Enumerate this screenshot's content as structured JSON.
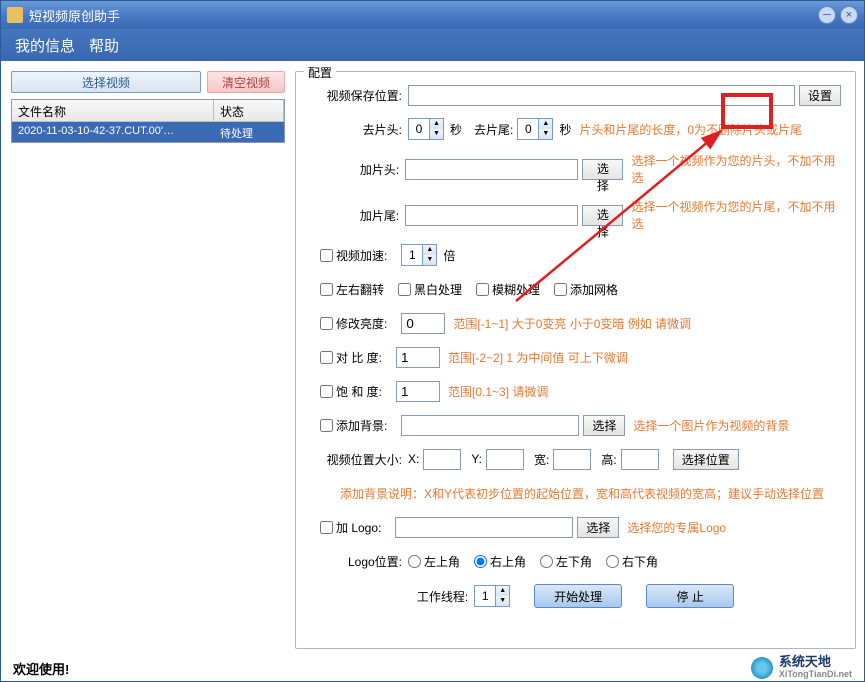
{
  "titlebar": {
    "title": "短视频原创助手"
  },
  "menu": {
    "myinfo": "我的信息",
    "help": "帮助"
  },
  "left": {
    "select_video": "选择视频",
    "clear_video": "清空视频",
    "col_name": "文件名称",
    "col_status": "状态",
    "row_file": "2020-11-03-10-42-37.CUT.00'…",
    "row_status": "待处理"
  },
  "config": {
    "legend": "配置",
    "save_loc_label": "视频保存位置:",
    "save_loc_value": "",
    "set_btn": "设置",
    "trim_head_label": "去片头:",
    "trim_head_val": "0",
    "trim_tail_label": "去片尾:",
    "trim_tail_val": "0",
    "sec": "秒",
    "trim_hint": "片头和片尾的长度，0为不删除片头或片尾",
    "add_head_label": "加片头:",
    "select_btn": "选择",
    "add_head_hint": "选择一个视频作为您的片头，不加不用选",
    "add_tail_label": "加片尾:",
    "add_tail_hint": "选择一个视频作为您的片尾，不加不用选",
    "speed_chk": "视频加速:",
    "speed_val": "1",
    "speed_unit": "倍",
    "flip_chk": "左右翻转",
    "bw_chk": "黑白处理",
    "blur_chk": "模糊处理",
    "grid_chk": "添加网格",
    "bright_chk": "修改亮度:",
    "bright_val": "0",
    "bright_hint": "范围[-1~1]   大于0变亮 小于0变暗  例如 请微调",
    "contrast_chk": "对 比  度:",
    "contrast_val": "1",
    "contrast_hint": "范围[-2~2]  1 为中间值  可上下微调",
    "saturate_chk": "饱 和  度:",
    "saturate_val": "1",
    "saturate_hint": "范围[0.1~3]   请微调",
    "bg_chk": "添加背景:",
    "bg_hint": "选择一个图片作为视频的背景",
    "pos_label": "视频位置大小:",
    "x_label": "X:",
    "y_label": "Y:",
    "w_label": "宽:",
    "h_label": "高:",
    "pos_btn": "选择位置",
    "pos_hint": "添加背景说明：X和Y代表初步位置的起始位置，宽和高代表视频的宽高；建议手动选择位置",
    "logo_chk": "加 Logo:",
    "logo_hint": "选择您的专属Logo",
    "logo_pos_label": "Logo位置:",
    "pos_tl": "左上角",
    "pos_tr": "右上角",
    "pos_bl": "左下角",
    "pos_br": "右下角",
    "threads_label": "工作线程:",
    "threads_val": "1",
    "start_btn": "开始处理",
    "stop_btn": "停    止"
  },
  "status": {
    "welcome": "欢迎使用!"
  },
  "watermark": {
    "cn": "系统天地",
    "en": "XiTongTianDi.net"
  }
}
